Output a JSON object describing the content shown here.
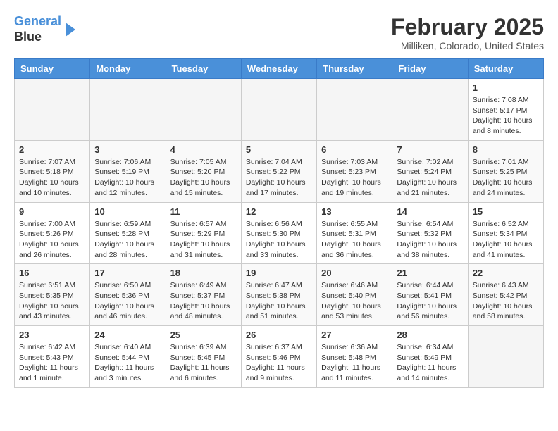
{
  "header": {
    "logo_line1": "General",
    "logo_line2": "Blue",
    "title": "February 2025",
    "subtitle": "Milliken, Colorado, United States"
  },
  "weekdays": [
    "Sunday",
    "Monday",
    "Tuesday",
    "Wednesday",
    "Thursday",
    "Friday",
    "Saturday"
  ],
  "weeks": [
    [
      {
        "day": "",
        "info": ""
      },
      {
        "day": "",
        "info": ""
      },
      {
        "day": "",
        "info": ""
      },
      {
        "day": "",
        "info": ""
      },
      {
        "day": "",
        "info": ""
      },
      {
        "day": "",
        "info": ""
      },
      {
        "day": "1",
        "info": "Sunrise: 7:08 AM\nSunset: 5:17 PM\nDaylight: 10 hours and 8 minutes."
      }
    ],
    [
      {
        "day": "2",
        "info": "Sunrise: 7:07 AM\nSunset: 5:18 PM\nDaylight: 10 hours and 10 minutes."
      },
      {
        "day": "3",
        "info": "Sunrise: 7:06 AM\nSunset: 5:19 PM\nDaylight: 10 hours and 12 minutes."
      },
      {
        "day": "4",
        "info": "Sunrise: 7:05 AM\nSunset: 5:20 PM\nDaylight: 10 hours and 15 minutes."
      },
      {
        "day": "5",
        "info": "Sunrise: 7:04 AM\nSunset: 5:22 PM\nDaylight: 10 hours and 17 minutes."
      },
      {
        "day": "6",
        "info": "Sunrise: 7:03 AM\nSunset: 5:23 PM\nDaylight: 10 hours and 19 minutes."
      },
      {
        "day": "7",
        "info": "Sunrise: 7:02 AM\nSunset: 5:24 PM\nDaylight: 10 hours and 21 minutes."
      },
      {
        "day": "8",
        "info": "Sunrise: 7:01 AM\nSunset: 5:25 PM\nDaylight: 10 hours and 24 minutes."
      }
    ],
    [
      {
        "day": "9",
        "info": "Sunrise: 7:00 AM\nSunset: 5:26 PM\nDaylight: 10 hours and 26 minutes."
      },
      {
        "day": "10",
        "info": "Sunrise: 6:59 AM\nSunset: 5:28 PM\nDaylight: 10 hours and 28 minutes."
      },
      {
        "day": "11",
        "info": "Sunrise: 6:57 AM\nSunset: 5:29 PM\nDaylight: 10 hours and 31 minutes."
      },
      {
        "day": "12",
        "info": "Sunrise: 6:56 AM\nSunset: 5:30 PM\nDaylight: 10 hours and 33 minutes."
      },
      {
        "day": "13",
        "info": "Sunrise: 6:55 AM\nSunset: 5:31 PM\nDaylight: 10 hours and 36 minutes."
      },
      {
        "day": "14",
        "info": "Sunrise: 6:54 AM\nSunset: 5:32 PM\nDaylight: 10 hours and 38 minutes."
      },
      {
        "day": "15",
        "info": "Sunrise: 6:52 AM\nSunset: 5:34 PM\nDaylight: 10 hours and 41 minutes."
      }
    ],
    [
      {
        "day": "16",
        "info": "Sunrise: 6:51 AM\nSunset: 5:35 PM\nDaylight: 10 hours and 43 minutes."
      },
      {
        "day": "17",
        "info": "Sunrise: 6:50 AM\nSunset: 5:36 PM\nDaylight: 10 hours and 46 minutes."
      },
      {
        "day": "18",
        "info": "Sunrise: 6:49 AM\nSunset: 5:37 PM\nDaylight: 10 hours and 48 minutes."
      },
      {
        "day": "19",
        "info": "Sunrise: 6:47 AM\nSunset: 5:38 PM\nDaylight: 10 hours and 51 minutes."
      },
      {
        "day": "20",
        "info": "Sunrise: 6:46 AM\nSunset: 5:40 PM\nDaylight: 10 hours and 53 minutes."
      },
      {
        "day": "21",
        "info": "Sunrise: 6:44 AM\nSunset: 5:41 PM\nDaylight: 10 hours and 56 minutes."
      },
      {
        "day": "22",
        "info": "Sunrise: 6:43 AM\nSunset: 5:42 PM\nDaylight: 10 hours and 58 minutes."
      }
    ],
    [
      {
        "day": "23",
        "info": "Sunrise: 6:42 AM\nSunset: 5:43 PM\nDaylight: 11 hours and 1 minute."
      },
      {
        "day": "24",
        "info": "Sunrise: 6:40 AM\nSunset: 5:44 PM\nDaylight: 11 hours and 3 minutes."
      },
      {
        "day": "25",
        "info": "Sunrise: 6:39 AM\nSunset: 5:45 PM\nDaylight: 11 hours and 6 minutes."
      },
      {
        "day": "26",
        "info": "Sunrise: 6:37 AM\nSunset: 5:46 PM\nDaylight: 11 hours and 9 minutes."
      },
      {
        "day": "27",
        "info": "Sunrise: 6:36 AM\nSunset: 5:48 PM\nDaylight: 11 hours and 11 minutes."
      },
      {
        "day": "28",
        "info": "Sunrise: 6:34 AM\nSunset: 5:49 PM\nDaylight: 11 hours and 14 minutes."
      },
      {
        "day": "",
        "info": ""
      }
    ]
  ]
}
